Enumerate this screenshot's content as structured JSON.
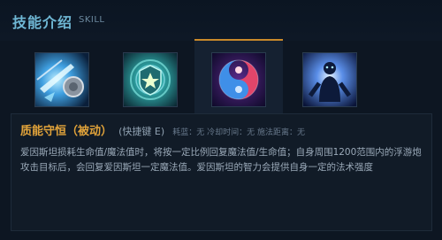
{
  "header": {
    "title": "技能介绍",
    "subtitle": "SKILL"
  },
  "skills": [
    {
      "icon": "ice-hammer-icon",
      "active": false
    },
    {
      "icon": "shield-emblem-icon",
      "active": false
    },
    {
      "icon": "yin-yang-swirl-icon",
      "active": true
    },
    {
      "icon": "glowing-figure-icon",
      "active": false
    }
  ],
  "detail": {
    "name": "质能守恒（被动）",
    "hotkey": "(快捷键 E)",
    "stats": "耗蓝：无  冷却时间：无  施法距离：无",
    "description": "爱因斯坦损耗生命值/魔法值时，将按一定比例回复魔法值/生命值；自身周围1200范围内的浮游炮攻击目标后，会回复爱因斯坦一定魔法值。爱因斯坦的智力会提供自身一定的法术强度"
  },
  "colors": {
    "accent": "#c9892a",
    "title": "#6fb7d4",
    "skill_name": "#e1a33a"
  }
}
